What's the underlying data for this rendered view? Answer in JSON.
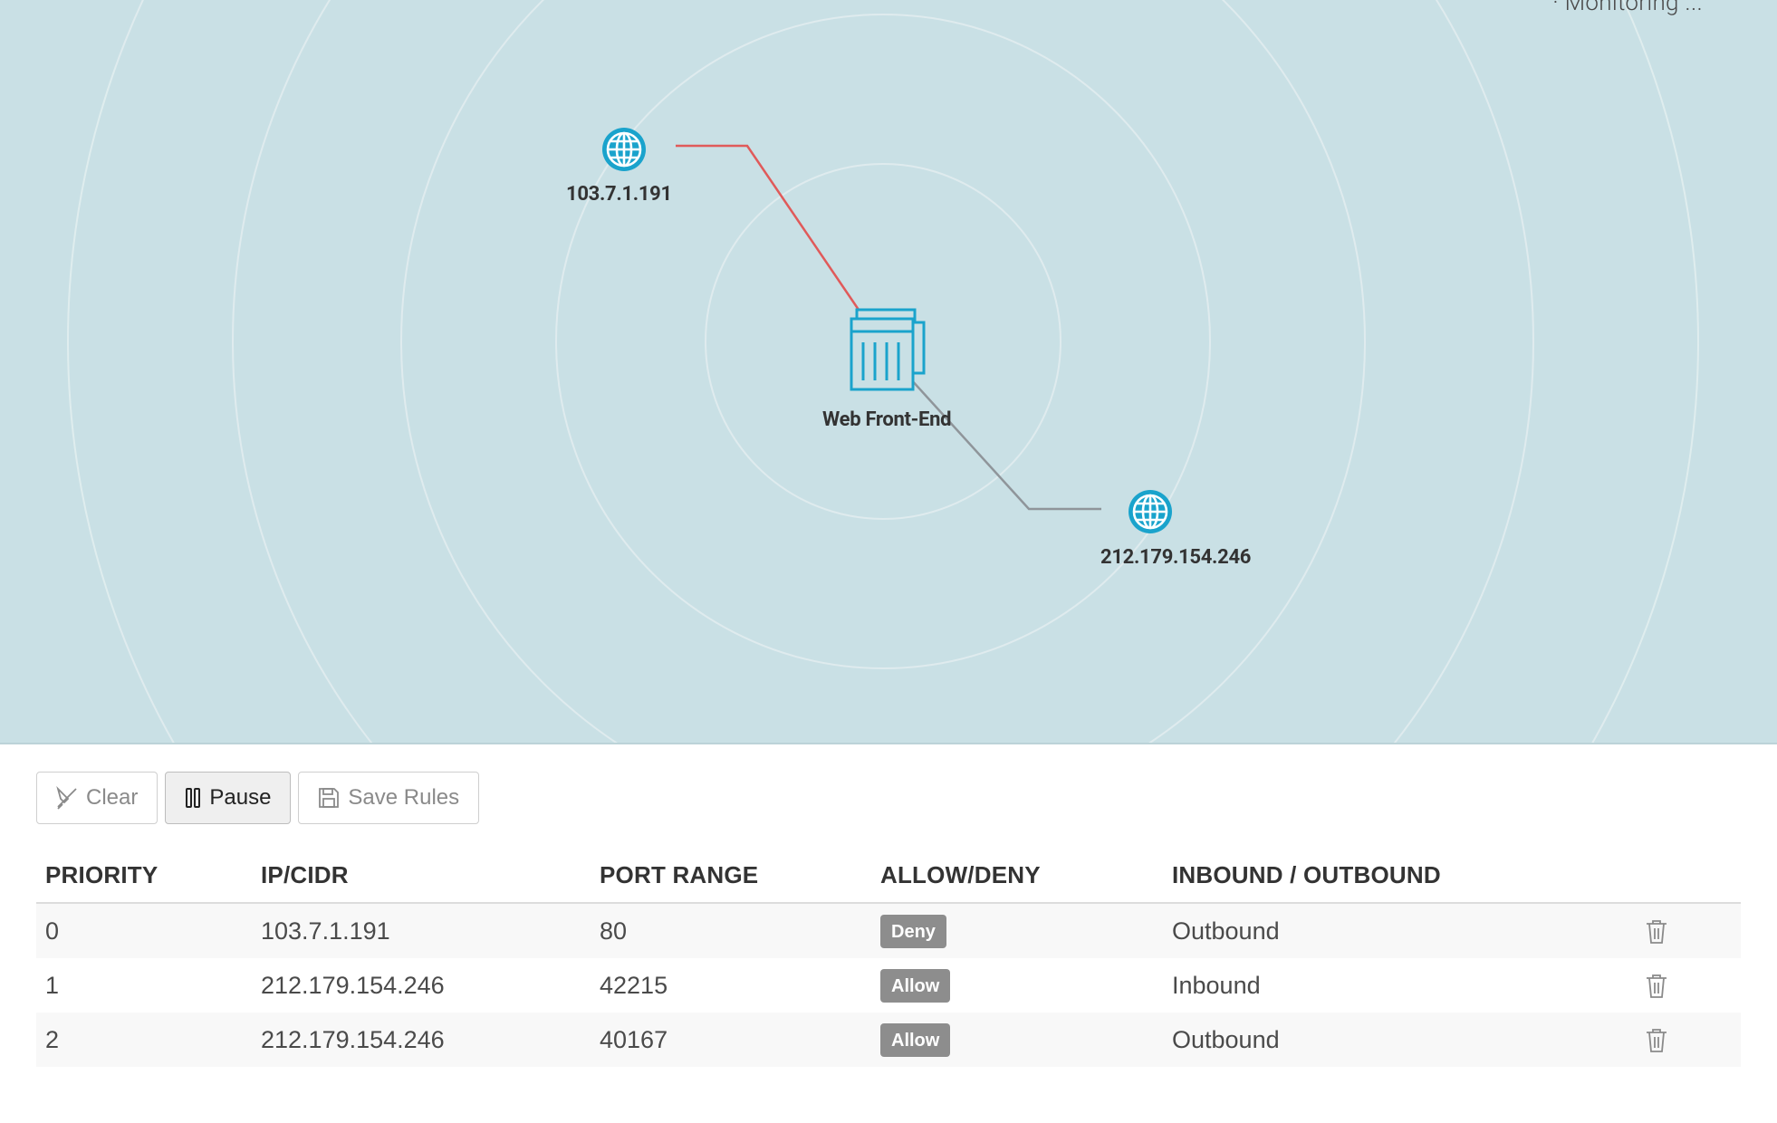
{
  "status": {
    "text": "· Monitoring ..."
  },
  "topology": {
    "center_node": {
      "label": "Web Front-End",
      "icon": "server-cluster-icon"
    },
    "remote_nodes": [
      {
        "label": "103.7.1.191",
        "icon": "globe-icon",
        "link_status": "deny",
        "link_color": "#e05a5a"
      },
      {
        "label": "212.179.154.246",
        "icon": "globe-icon",
        "link_status": "allow",
        "link_color": "#8f959a"
      }
    ]
  },
  "toolbar": {
    "clear_label": "Clear",
    "pause_label": "Pause",
    "save_label": "Save Rules"
  },
  "table": {
    "headers": [
      "PRIORITY",
      "IP/CIDR",
      "PORT RANGE",
      "ALLOW/DENY",
      "INBOUND / OUTBOUND",
      ""
    ],
    "rows": [
      {
        "priority": "0",
        "ip": "103.7.1.191",
        "port": "80",
        "action": "Deny",
        "direction": "Outbound"
      },
      {
        "priority": "1",
        "ip": "212.179.154.246",
        "port": "42215",
        "action": "Allow",
        "direction": "Inbound"
      },
      {
        "priority": "2",
        "ip": "212.179.154.246",
        "port": "40167",
        "action": "Allow",
        "direction": "Outbound"
      }
    ]
  },
  "colors": {
    "canvas_bg": "#c9e0e5",
    "icon_accent": "#1aa3cc",
    "deny_link": "#e05a5a",
    "allow_link": "#8f959a",
    "badge_bg": "#8d8d8d"
  }
}
